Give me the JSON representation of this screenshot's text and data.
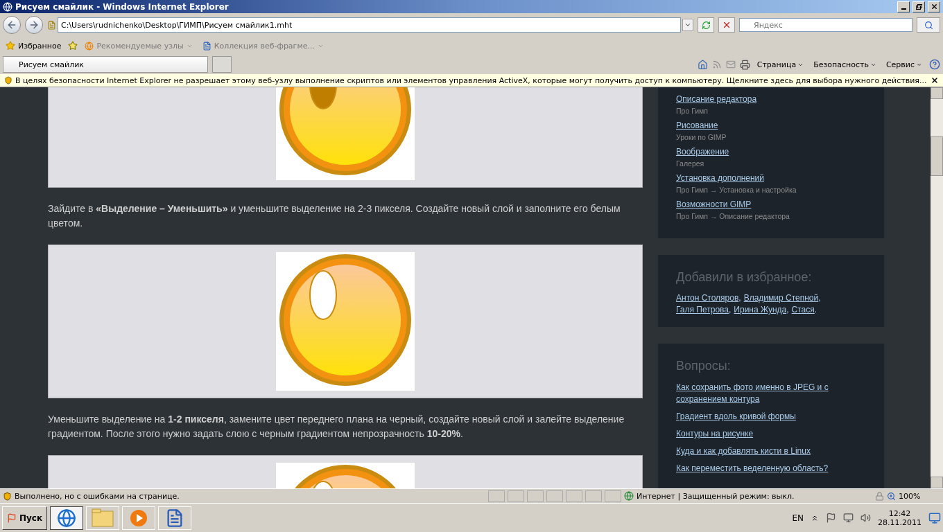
{
  "window": {
    "title": "Рисуем смайлик - Windows Internet Explorer"
  },
  "address_bar": {
    "value": "C:\\Users\\rudnichenko\\Desktop\\ГИМП\\Рисуем смайлик1.mht"
  },
  "search": {
    "placeholder": "Яндекс"
  },
  "favorites_bar": {
    "label": "Избранное",
    "items": [
      {
        "label": "Рекомендуемые узлы"
      },
      {
        "label": "Коллекция веб-фрагме..."
      }
    ]
  },
  "tabs": [
    {
      "label": "Рисуем смайлик",
      "selected": true
    }
  ],
  "command_bar": [
    {
      "label": "Страница"
    },
    {
      "label": "Безопасность"
    },
    {
      "label": "Сервис"
    }
  ],
  "info_bar": {
    "text": "В целях безопасности Internet Explorer не разрешает этому веб-узлу выполнение скриптов или элементов управления ActiveX, которые могут получить доступ к компьютеру. Щелкните здесь для выбора нужного действия..."
  },
  "article": [
    {
      "kind": "picture"
    },
    {
      "kind": "paragraph",
      "text": "Зайдите в **«Выделение – Уменьшить»** и уменьшите выделение на 2-3 пикселя. Создайте новый слой и заполните его белым цветом."
    },
    {
      "kind": "picture"
    },
    {
      "kind": "paragraph",
      "text": "Уменьшите выделение на **1-2 пикселя**, замените цвет переднего плана на черный, создайте новый слой и залейте выделение градиентом. После этого нужно задать слою с черным градиентом непрозрачность **10-20%**."
    },
    {
      "kind": "picture"
    }
  ],
  "sidebar": [
    {
      "kind": "sections",
      "items": [
        {
          "link": "Описание редактора",
          "path": "Про Гимп"
        },
        {
          "link": "Рисование",
          "path": "Уроки по GIMP"
        },
        {
          "link": "Воображение",
          "path": "Галерея"
        },
        {
          "link": "Установка дополнений",
          "path": "Про Гимп → Установка и настройка"
        },
        {
          "link": "Возможности GIMP",
          "path": "Про Гимп → Описание редактора"
        }
      ]
    },
    {
      "kind": "people",
      "title": "Добавили в избранное:",
      "names": [
        {
          "name": "Антон Столяров",
          "separator": ","
        },
        {
          "name": "Владимир Степной",
          "separator": ","
        },
        {
          "name": "Галя Петрова",
          "separator": ","
        },
        {
          "name": "Ирина Жунда",
          "separator": ","
        },
        {
          "name": "Стася",
          "separator": "."
        }
      ]
    },
    {
      "kind": "questions",
      "title": "Вопросы:",
      "links": [
        "Как сохранить фото именно в JPEG и с сохранением контура",
        "Градиент вдоль кривой формы",
        "Контуры на рисунке",
        "Куда и как добавлять кисти в Linux",
        "Как переместить веделенную область?"
      ]
    }
  ],
  "status_bar": {
    "text": "Выполнено, но с ошибками на странице.",
    "zone": "Интернет | Защищенный режим: выкл.",
    "zoom": "100%"
  },
  "taskbar": {
    "start": "Пуск",
    "apps": [
      {
        "kind": "browser",
        "selected": true
      },
      {
        "kind": "folder",
        "selected": false
      },
      {
        "kind": "media",
        "selected": false
      },
      {
        "kind": "word",
        "selected": false
      }
    ],
    "language": "EN",
    "time": "12:42",
    "date": "28.11.2011"
  }
}
